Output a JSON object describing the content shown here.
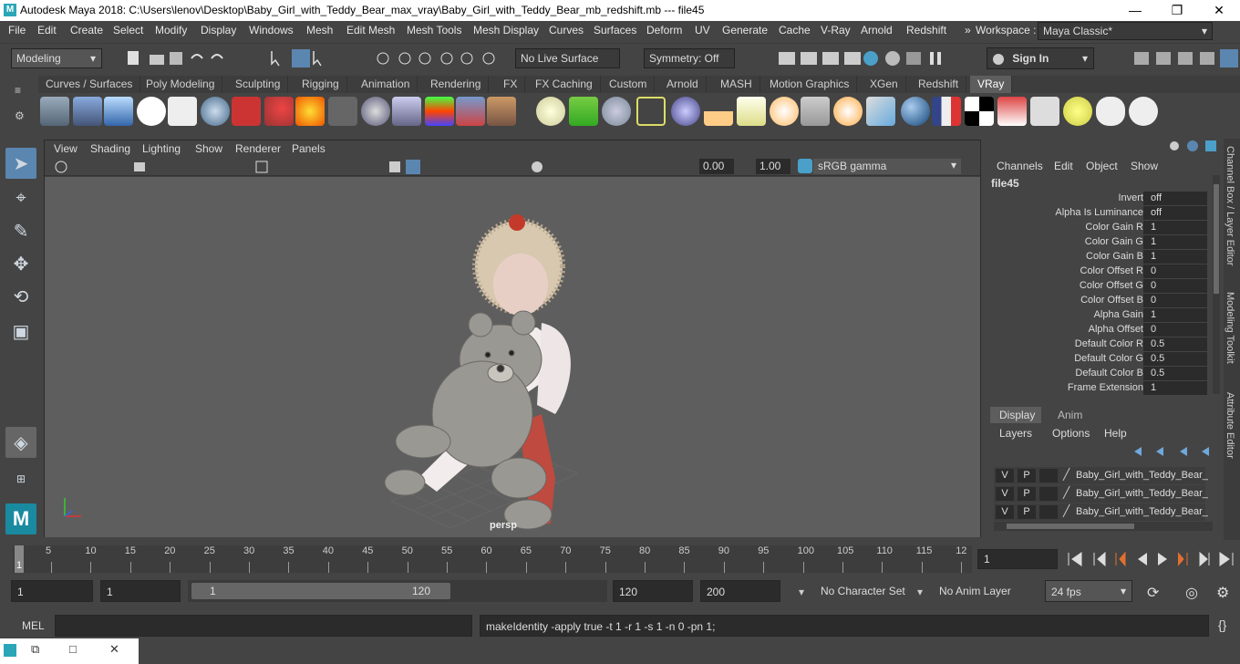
{
  "window": {
    "title": "Autodesk Maya 2018: C:\\Users\\lenov\\Desktop\\Baby_Girl_with_Teddy_Bear_max_vray\\Baby_Girl_with_Teddy_Bear_mb_redshift.mb   ---   file45",
    "logo": "M",
    "minimize": "—",
    "maximize": "❐",
    "close": "✕"
  },
  "menubar": {
    "items": [
      "File",
      "Edit",
      "Create",
      "Select",
      "Modify",
      "Display",
      "Windows",
      "Mesh",
      "Edit Mesh",
      "Mesh Tools",
      "Mesh Display",
      "Curves",
      "Surfaces",
      "Deform",
      "UV",
      "Generate",
      "Cache",
      "V-Ray",
      "Arnold",
      "Redshift"
    ],
    "more": "»",
    "workspace_label": "Workspace :",
    "workspace_value": "Maya Classic*"
  },
  "statusline": {
    "mode": "Modeling",
    "live_surface": "No Live Surface",
    "symmetry": "Symmetry: Off",
    "sign_in": "Sign In"
  },
  "shelf": {
    "tabs": [
      "Curves / Surfaces",
      "Poly Modeling",
      "Sculpting",
      "Rigging",
      "Animation",
      "Rendering",
      "FX",
      "FX Caching",
      "Custom",
      "Arnold",
      "MASH",
      "Motion Graphics",
      "XGen",
      "Redshift",
      "VRay"
    ],
    "active_tab": "VRay"
  },
  "viewport": {
    "menus": [
      "View",
      "Shading",
      "Lighting",
      "Show",
      "Renderer",
      "Panels"
    ],
    "exposure": "0.00",
    "gamma": "1.00",
    "color_space": "sRGB gamma",
    "camera_label": "persp"
  },
  "channelbox": {
    "menus": [
      "Channels",
      "Edit",
      "Object",
      "Show"
    ],
    "node": "file45",
    "attributes": [
      {
        "name": "Invert",
        "value": "off"
      },
      {
        "name": "Alpha Is Luminance",
        "value": "off"
      },
      {
        "name": "Color Gain R",
        "value": "1"
      },
      {
        "name": "Color Gain G",
        "value": "1"
      },
      {
        "name": "Color Gain B",
        "value": "1"
      },
      {
        "name": "Color Offset R",
        "value": "0"
      },
      {
        "name": "Color Offset G",
        "value": "0"
      },
      {
        "name": "Color Offset B",
        "value": "0"
      },
      {
        "name": "Alpha Gain",
        "value": "1"
      },
      {
        "name": "Alpha Offset",
        "value": "0"
      },
      {
        "name": "Default Color R",
        "value": "0.5"
      },
      {
        "name": "Default Color G",
        "value": "0.5"
      },
      {
        "name": "Default Color B",
        "value": "0.5"
      },
      {
        "name": "Frame Extension",
        "value": "1"
      }
    ]
  },
  "side_tabs": [
    "Channel Box / Layer Editor",
    "Modeling Toolkit",
    "Attribute Editor"
  ],
  "layers": {
    "tabs": [
      "Display",
      "Anim"
    ],
    "menus": [
      "Layers",
      "Options",
      "Help"
    ],
    "rows": [
      {
        "v": "V",
        "p": "P",
        "name": "Baby_Girl_with_Teddy_Bear_"
      },
      {
        "v": "V",
        "p": "P",
        "name": "Baby_Girl_with_Teddy_Bear_"
      },
      {
        "v": "V",
        "p": "P",
        "name": "Baby_Girl_with_Teddy_Bear_"
      }
    ]
  },
  "timeline": {
    "ticks": [
      "5",
      "10",
      "15",
      "20",
      "25",
      "30",
      "35",
      "40",
      "45",
      "50",
      "55",
      "60",
      "65",
      "70",
      "75",
      "80",
      "85",
      "90",
      "95",
      "100",
      "105",
      "110",
      "115",
      "12"
    ],
    "current_marker": "1",
    "current_frame": "1"
  },
  "range": {
    "start": "1",
    "playback_start": "1",
    "slider_start": "1",
    "slider_end": "120",
    "playback_end": "120",
    "end": "200",
    "character_set": "No Character Set",
    "anim_layer": "No Anim Layer",
    "fps": "24 fps"
  },
  "commandline": {
    "language": "MEL",
    "result": "makeIdentity -apply true -t 1 -r 1 -s 1 -n 0 -pn 1;"
  }
}
